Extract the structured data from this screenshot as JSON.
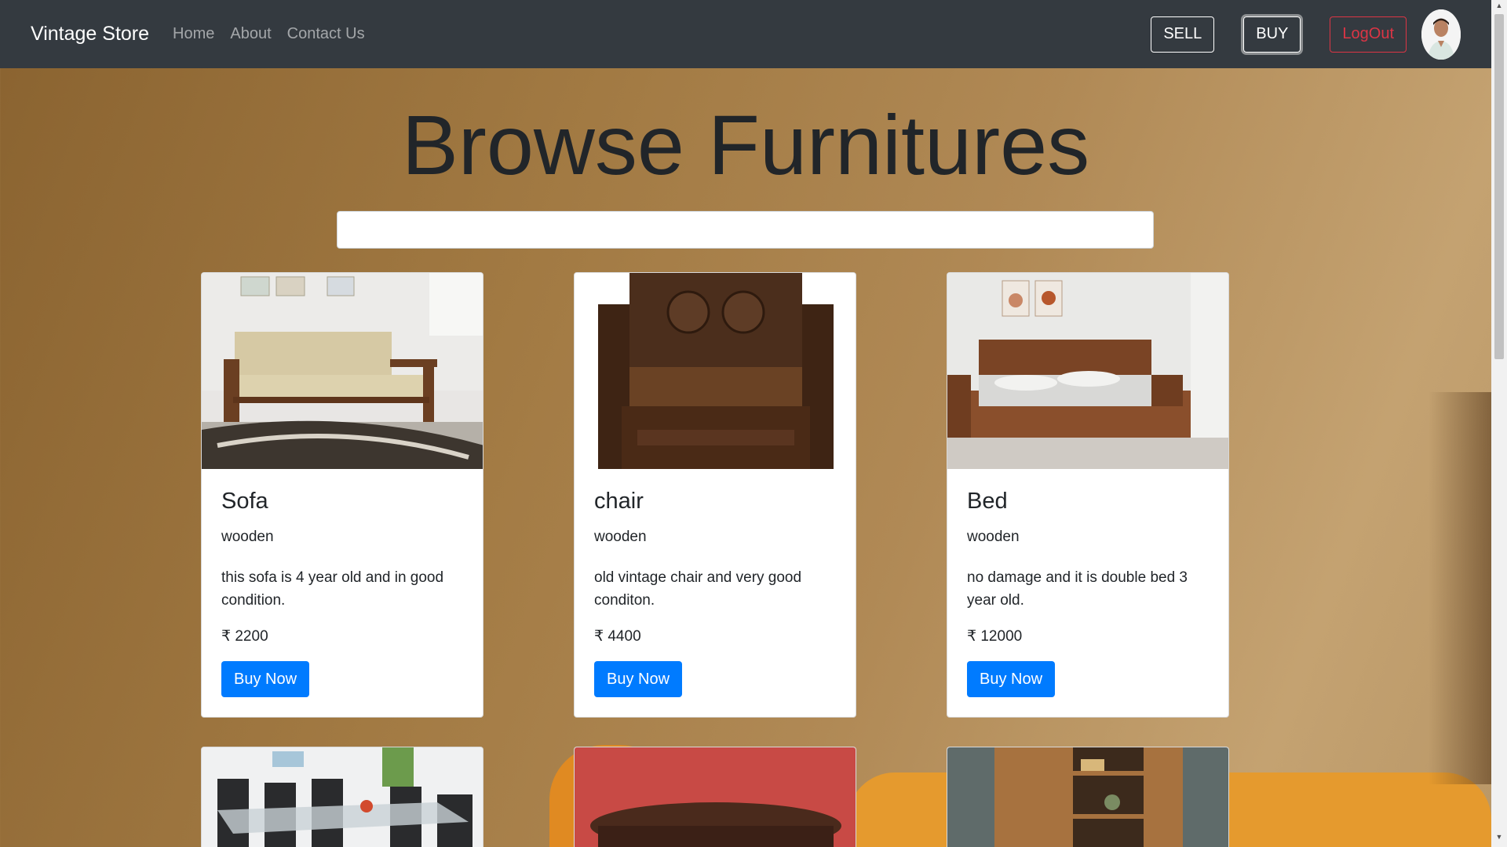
{
  "navbar": {
    "brand": "Vintage Store",
    "links": [
      "Home",
      "About",
      "Contact Us"
    ],
    "sell_label": "SELL",
    "buy_label": "BUY",
    "logout_label": "LogOut"
  },
  "page": {
    "title": "Browse Furnitures",
    "search_value": ""
  },
  "products": [
    {
      "name": "Sofa",
      "material": "wooden",
      "description": "this sofa is 4 year old and in good condition.",
      "price": "₹ 2200",
      "button": "Buy Now"
    },
    {
      "name": "chair",
      "material": "wooden",
      "description": "old vintage chair and very good conditon.",
      "price": "₹ 4400",
      "button": "Buy Now"
    },
    {
      "name": "Bed",
      "material": "wooden",
      "description": "no damage and it is double bed 3 year old.",
      "price": "₹ 12000",
      "button": "Buy Now"
    }
  ],
  "colors": {
    "navbar": "#343a40",
    "primary": "#007bff",
    "danger": "#dc3545"
  }
}
